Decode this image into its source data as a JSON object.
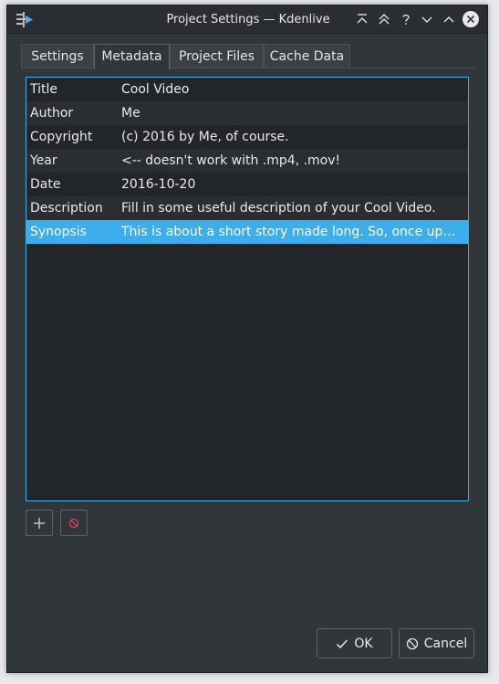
{
  "window": {
    "title": "Project Settings — Kdenlive"
  },
  "tabs": [
    {
      "label": "Settings"
    },
    {
      "label": "Metadata",
      "active": true
    },
    {
      "label": "Project Files"
    },
    {
      "label": "Cache Data"
    }
  ],
  "metadata": {
    "rows": [
      {
        "key": "Title",
        "value": "Cool Video"
      },
      {
        "key": "Author",
        "value": "Me"
      },
      {
        "key": "Copyright",
        "value": "(c) 2016 by Me, of course."
      },
      {
        "key": "Year",
        "value": "<-- doesn't work with .mp4, .mov!"
      },
      {
        "key": "Date",
        "value": "2016-10-20"
      },
      {
        "key": "Description",
        "value": "Fill in some useful description of your Cool Video."
      },
      {
        "key": "Synopsis",
        "value": "This is about a short story made long. So, once upo...",
        "selected": true
      }
    ]
  },
  "buttons": {
    "ok": "OK",
    "cancel": "Cancel"
  },
  "icons": {
    "app": "kdenlive-icon",
    "add": "plus-icon",
    "remove": "delete-icon",
    "ok": "checkmark-icon",
    "cancel": "cancel-icon"
  },
  "colors": {
    "accent": "#3daee9",
    "window_bg": "#31363b",
    "table_bg": "#232629",
    "remove_icon": "#da4453"
  }
}
